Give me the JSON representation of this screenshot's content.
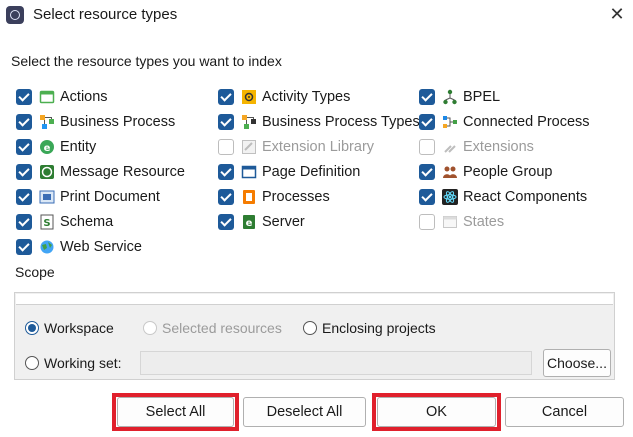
{
  "dialog": {
    "title": "Select resource types",
    "close_glyph": "✕"
  },
  "instruction": "Select the resource types you want to index",
  "resource_types": [
    {
      "label": "Actions",
      "checked": true,
      "enabled": true,
      "icon": "actions-icon"
    },
    {
      "label": "Business Process",
      "checked": true,
      "enabled": true,
      "icon": "business-process-icon"
    },
    {
      "label": "Entity",
      "checked": true,
      "enabled": true,
      "icon": "entity-icon"
    },
    {
      "label": "Message Resource",
      "checked": true,
      "enabled": true,
      "icon": "message-resource-icon"
    },
    {
      "label": "Print Document",
      "checked": true,
      "enabled": true,
      "icon": "print-document-icon"
    },
    {
      "label": "Schema",
      "checked": true,
      "enabled": true,
      "icon": "schema-icon"
    },
    {
      "label": "Web Service",
      "checked": true,
      "enabled": true,
      "icon": "web-service-icon"
    },
    {
      "label": "Activity Types",
      "checked": true,
      "enabled": true,
      "icon": "activity-types-icon"
    },
    {
      "label": "Business Process Types",
      "checked": true,
      "enabled": true,
      "icon": "business-process-types-icon"
    },
    {
      "label": "Extension Library",
      "checked": false,
      "enabled": false,
      "icon": "extension-library-icon"
    },
    {
      "label": "Page Definition",
      "checked": true,
      "enabled": true,
      "icon": "page-definition-icon"
    },
    {
      "label": "Processes",
      "checked": true,
      "enabled": true,
      "icon": "processes-icon"
    },
    {
      "label": "Server",
      "checked": true,
      "enabled": true,
      "icon": "server-icon"
    },
    {
      "label": "BPEL",
      "checked": true,
      "enabled": true,
      "icon": "bpel-icon"
    },
    {
      "label": "Connected Process",
      "checked": true,
      "enabled": true,
      "icon": "connected-process-icon"
    },
    {
      "label": "Extensions",
      "checked": false,
      "enabled": false,
      "icon": "extensions-icon"
    },
    {
      "label": "People Group",
      "checked": true,
      "enabled": true,
      "icon": "people-group-icon"
    },
    {
      "label": "React Components",
      "checked": true,
      "enabled": true,
      "icon": "react-components-icon"
    },
    {
      "label": "States",
      "checked": false,
      "enabled": false,
      "icon": "states-icon"
    }
  ],
  "scope": {
    "label": "Scope",
    "workspace": {
      "label": "Workspace",
      "selected": true
    },
    "selected_resources": {
      "label": "Selected resources",
      "selected": false,
      "enabled": false
    },
    "enclosing_projects": {
      "label": "Enclosing projects",
      "selected": false
    },
    "working_set": {
      "label": "Working set:",
      "selected": false,
      "value": ""
    },
    "choose_label": "Choose..."
  },
  "buttons": {
    "select_all": "Select All",
    "deselect_all": "Deselect All",
    "ok": "OK",
    "cancel": "Cancel"
  },
  "colors": {
    "accent": "#1e5a99",
    "highlight": "#e0202c",
    "disabled_text": "#9b9b9b"
  }
}
